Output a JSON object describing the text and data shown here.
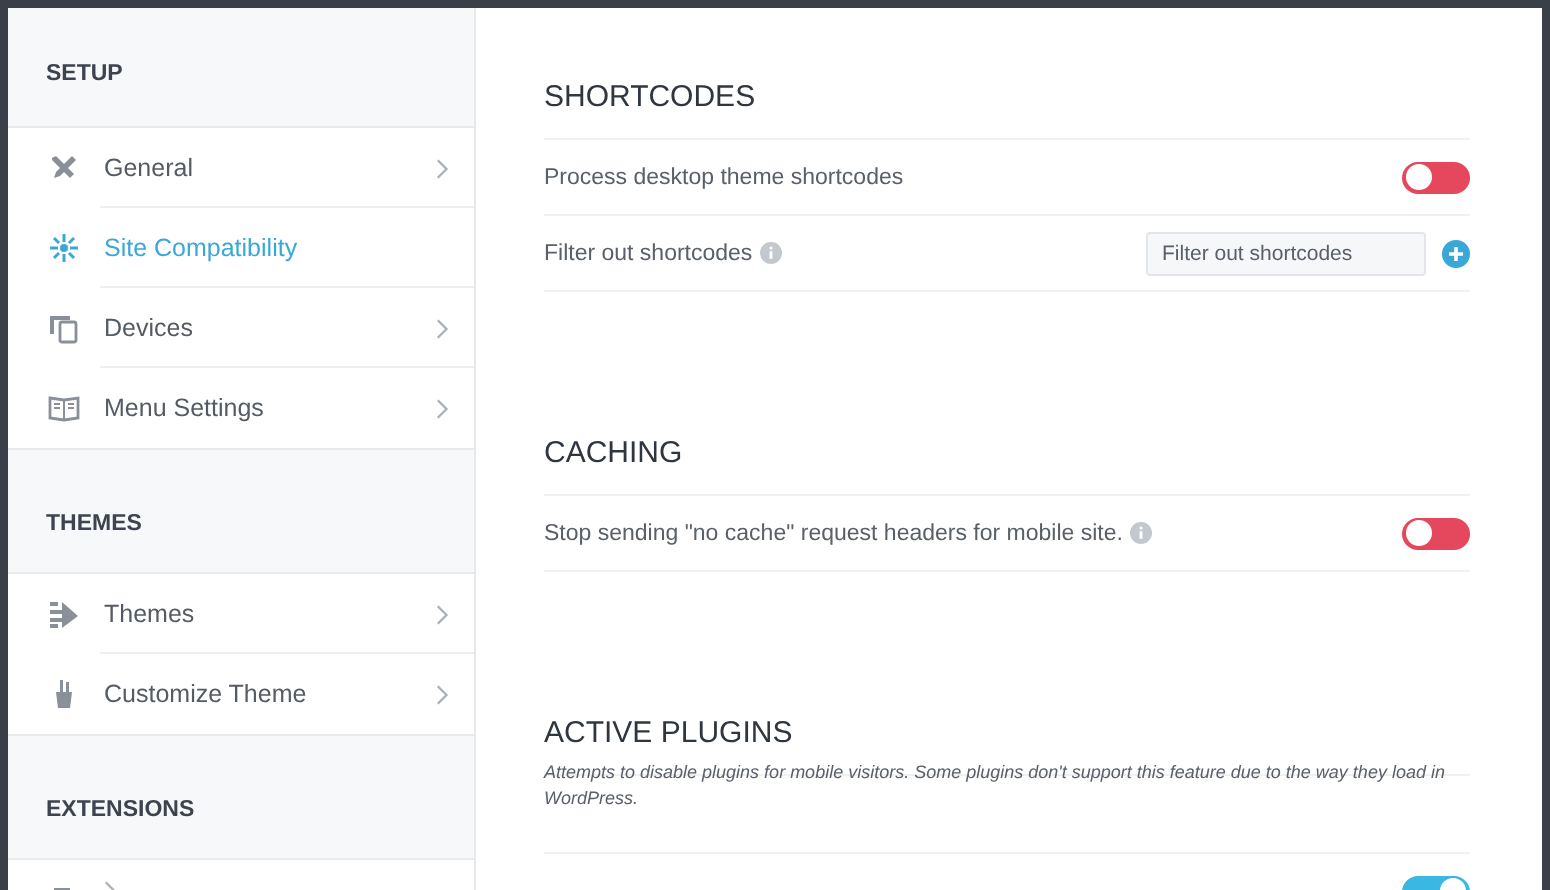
{
  "sidebar": {
    "groups": [
      {
        "title": "SETUP",
        "items": [
          {
            "label": "General",
            "selected": false
          },
          {
            "label": "Site Compatibility",
            "selected": true
          },
          {
            "label": "Devices",
            "selected": false
          },
          {
            "label": "Menu Settings",
            "selected": false
          }
        ]
      },
      {
        "title": "THEMES",
        "items": [
          {
            "label": "Themes",
            "selected": false
          },
          {
            "label": "Customize Theme",
            "selected": false
          }
        ]
      },
      {
        "title": "EXTENSIONS",
        "items": [
          {
            "selected": false
          }
        ]
      }
    ]
  },
  "sections": [
    {
      "title": "SHORTCODES",
      "rows": [
        {
          "kind": "toggle",
          "label": "Process desktop theme shortcodes",
          "info": false,
          "on": false
        },
        {
          "kind": "input",
          "label": "Filter out shortcodes",
          "info": true,
          "placeholder": "Filter out shortcodes"
        }
      ]
    },
    {
      "title": "CACHING",
      "rows": [
        {
          "kind": "toggle",
          "label": "Stop sending \"no cache\" request headers for mobile site.",
          "info": true,
          "on": false
        }
      ]
    },
    {
      "title": "ACTIVE PLUGINS",
      "description": "Attempts to disable plugins for mobile visitors. Some plugins don't support this feature due to the way they load in WordPress.",
      "rows": [
        {
          "kind": "toggle",
          "info": false,
          "on": true
        }
      ]
    }
  ]
}
